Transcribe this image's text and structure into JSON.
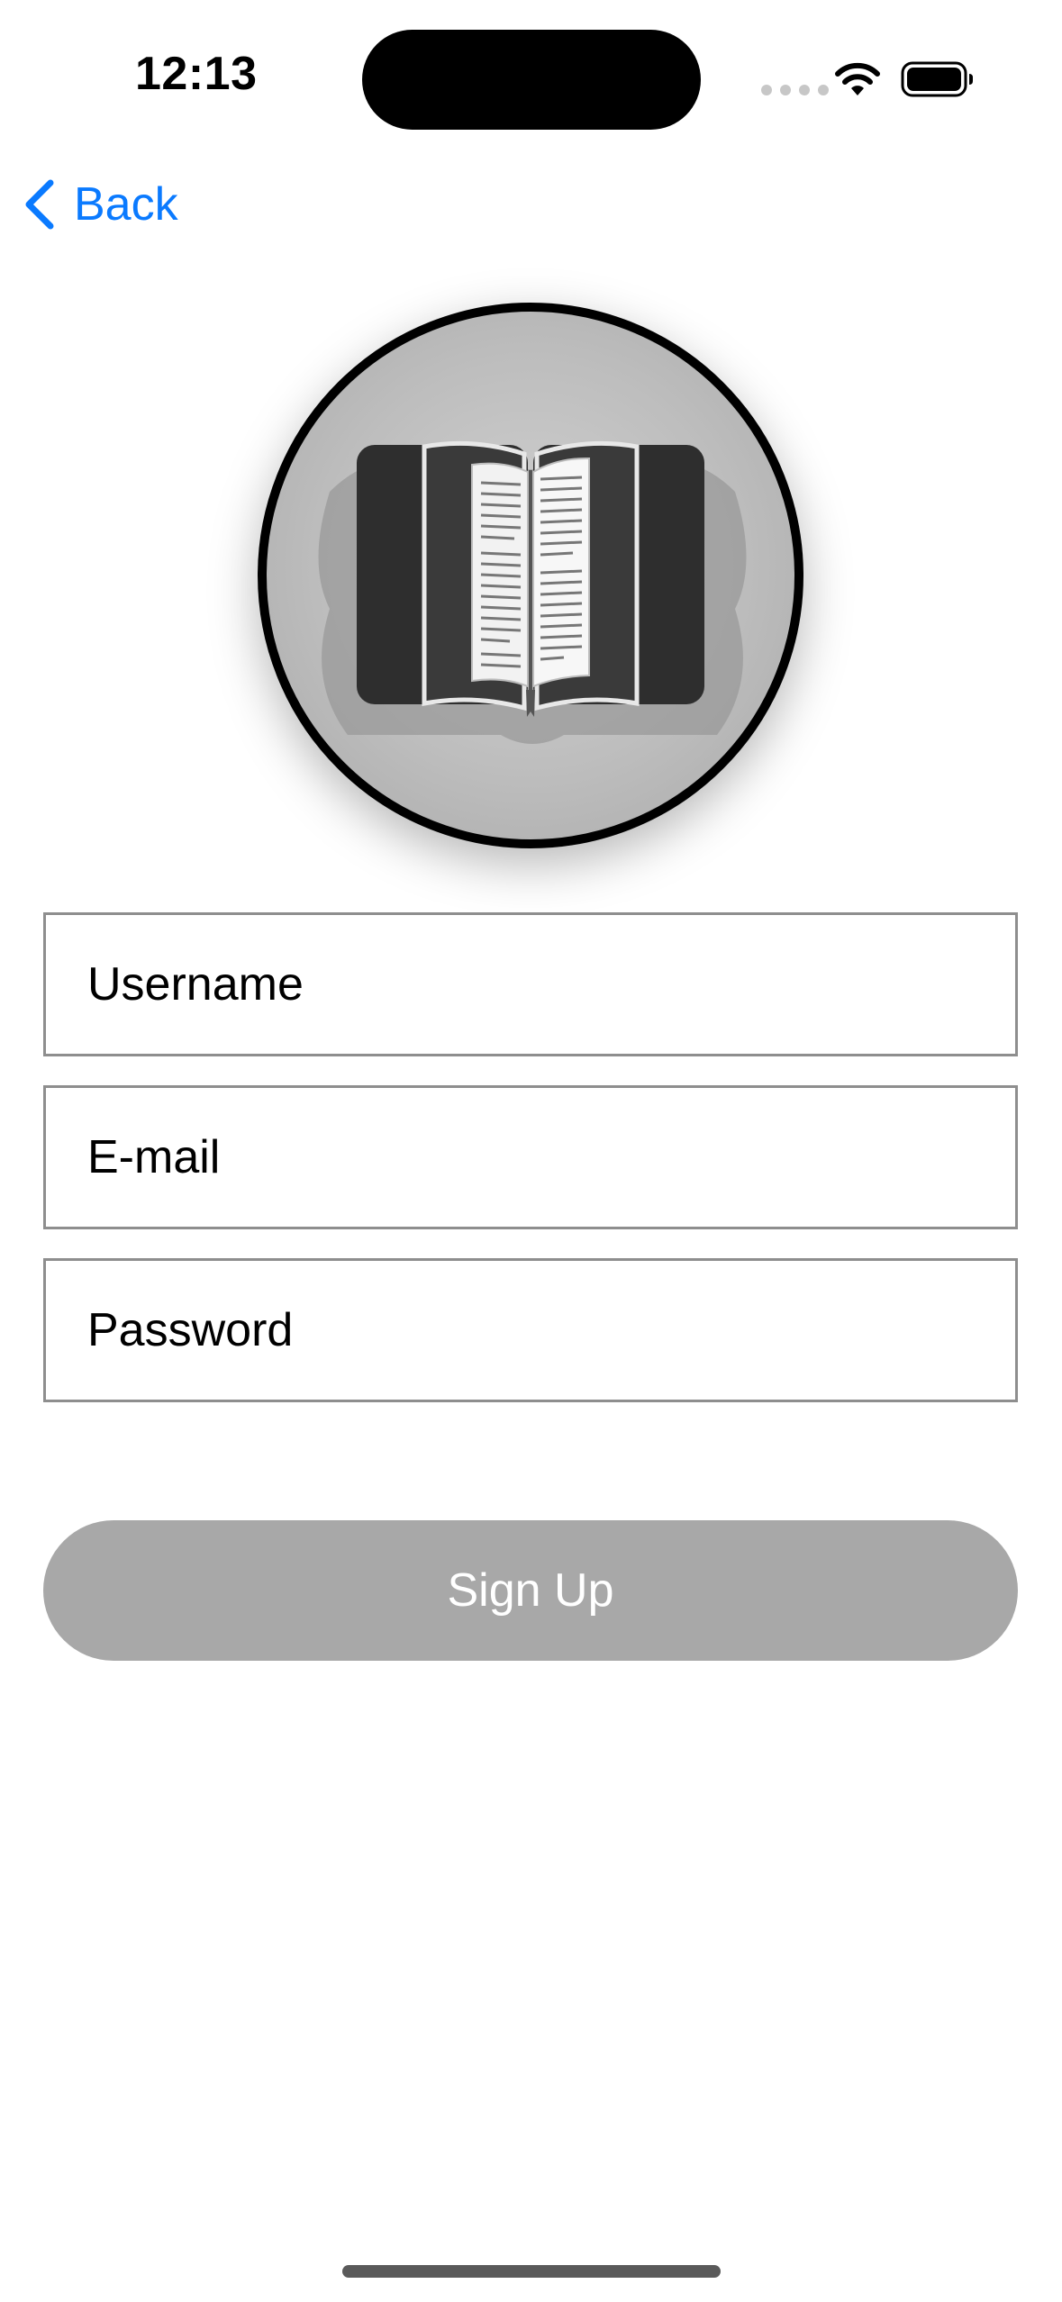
{
  "status_bar": {
    "time": "12:13",
    "icons": [
      "cellular-signal-icon",
      "wifi-icon",
      "battery-icon"
    ]
  },
  "nav": {
    "back_label": "Back",
    "back_icon": "chevron-left-icon"
  },
  "logo": {
    "icon": "open-book-icon"
  },
  "form": {
    "username_placeholder": "Username",
    "username_value": "",
    "email_placeholder": "E-mail",
    "email_value": "",
    "password_placeholder": "Password",
    "password_value": "",
    "signup_label": "Sign Up"
  },
  "colors": {
    "accent": "#0A7AFF",
    "button_disabled": "#A8A8A8",
    "field_border": "#8E8E8E"
  }
}
